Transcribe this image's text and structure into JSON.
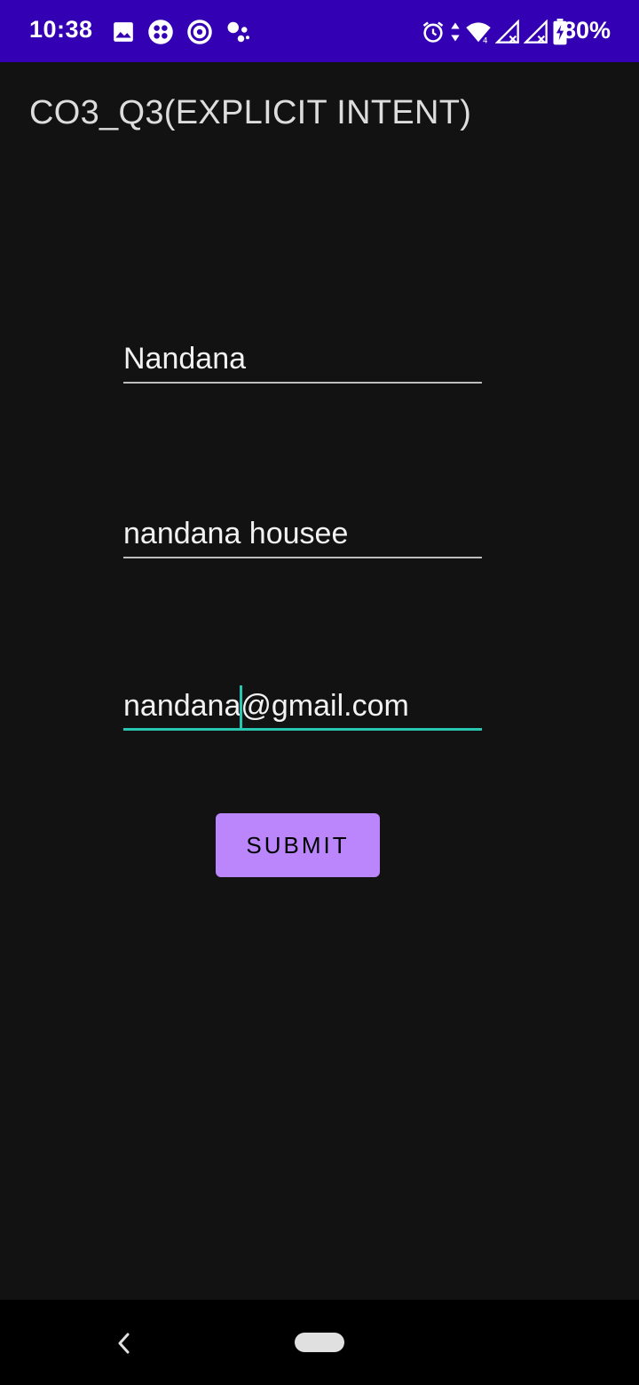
{
  "status_bar": {
    "time": "10:38",
    "battery": "80%",
    "icons": [
      "image-icon",
      "app-grid-icon",
      "at-sign-icon",
      "assistant-icon",
      "alarm-icon",
      "data-arrows-icon",
      "wifi-icon",
      "signal-icon",
      "signal-icon",
      "battery-charging-icon"
    ],
    "background_color": "#3300b3"
  },
  "app_bar": {
    "title": "CO3_Q3(EXPLICIT INTENT)"
  },
  "form": {
    "name_value": "Nandana",
    "address_value": "nandana housee",
    "email_value": "nandana@gmail.com",
    "email_before_cursor": "nandana",
    "email_after_cursor": "@gmail.com",
    "focus_color": "#26c6b0"
  },
  "submit_button": {
    "label": "SUBMIT",
    "color": "#bb86fc"
  },
  "nav_bar": {
    "icons": [
      "back-icon",
      "home-pill"
    ]
  }
}
